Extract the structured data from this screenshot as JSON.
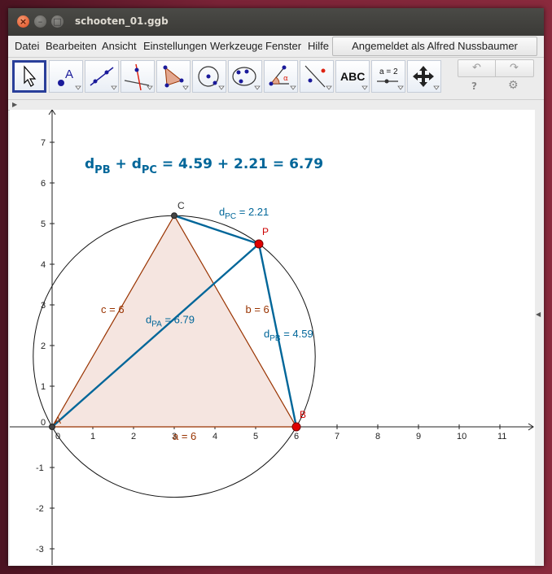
{
  "window": {
    "title": "schooten_01.ggb",
    "close_glyph": "×",
    "min_glyph": "–",
    "max_glyph": "□"
  },
  "menubar": {
    "items": [
      "Datei",
      "Bearbeiten",
      "Ansicht",
      "Einstellungen",
      "Werkzeuge",
      "Fenster",
      "Hilfe"
    ],
    "login_label": "Angemeldet als Alfred Nussbaumer"
  },
  "toolbar": {
    "tools": [
      {
        "name": "move-tool",
        "icon": "arrow-icon"
      },
      {
        "name": "point-tool",
        "icon": "point-icon"
      },
      {
        "name": "line-tool",
        "icon": "line-icon"
      },
      {
        "name": "perpendicular-tool",
        "icon": "perpendicular-icon"
      },
      {
        "name": "polygon-tool",
        "icon": "polygon-icon"
      },
      {
        "name": "circle-tool",
        "icon": "circle-icon"
      },
      {
        "name": "conic-tool",
        "icon": "ellipse-icon"
      },
      {
        "name": "angle-tool",
        "icon": "angle-icon"
      },
      {
        "name": "reflect-tool",
        "icon": "reflect-icon"
      },
      {
        "name": "text-tool",
        "icon": "text-icon",
        "label": "ABC"
      },
      {
        "name": "slider-tool",
        "icon": "slider-icon",
        "label": "a = 2"
      },
      {
        "name": "move-view-tool",
        "icon": "move-view-icon"
      }
    ],
    "undo_glyph": "↶",
    "redo_glyph": "↷",
    "help_glyph": "?",
    "settings_glyph": "⚙"
  },
  "graphics": {
    "x_ticks": [
      "0",
      "1",
      "2",
      "3",
      "4",
      "5",
      "6",
      "7",
      "8",
      "9",
      "10",
      "11"
    ],
    "y_ticks": [
      "-3",
      "-2",
      "-1",
      "0",
      "1",
      "2",
      "3",
      "4",
      "5",
      "6",
      "7"
    ],
    "headline": {
      "d1": "d",
      "s1": "PB",
      "plus": " + ",
      "d2": "d",
      "s2": "PC",
      "value": " = 4.59 + 2.21 = 6.79"
    },
    "points": {
      "A": {
        "label": "A",
        "x": 0,
        "y": 0
      },
      "B": {
        "label": "B",
        "x": 6,
        "y": 0
      },
      "C": {
        "label": "C",
        "x": 3,
        "y": 5.196
      },
      "P": {
        "label": "P",
        "x": 5.08,
        "y": 4.5
      }
    },
    "circle": {
      "cx": 3,
      "cy": 1.732,
      "r": 3.464
    },
    "labels": {
      "a": "a = 6",
      "b": "b = 6",
      "c": "c = 6",
      "dPA": {
        "base": "d",
        "sub": "PA",
        "val": " = 6.79"
      },
      "dPB": {
        "base": "d",
        "sub": "PB",
        "val": " = 4.59"
      },
      "dPC": {
        "base": "d",
        "sub": "PC",
        "val": " = 2.21"
      }
    },
    "colors": {
      "triangle_fill": "#f5e5e0",
      "triangle_edge": "#993300",
      "distance": "#006699",
      "free_point": "#e00000"
    }
  }
}
